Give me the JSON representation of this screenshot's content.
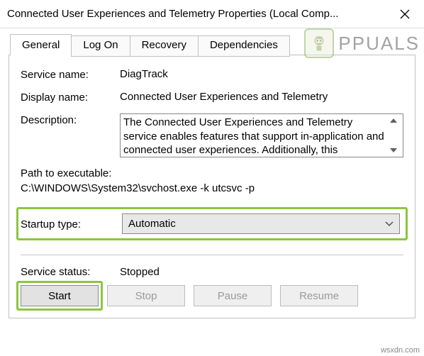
{
  "window": {
    "title": "Connected User Experiences and Telemetry Properties (Local Comp..."
  },
  "tabs": {
    "general": "General",
    "logon": "Log On",
    "recovery": "Recovery",
    "dependencies": "Dependencies"
  },
  "fields": {
    "service_name_label": "Service name:",
    "service_name_value": "DiagTrack",
    "display_name_label": "Display name:",
    "display_name_value": "Connected User Experiences and Telemetry",
    "description_label": "Description:",
    "description_value": "The Connected User Experiences and Telemetry service enables features that support in-application and connected user experiences. Additionally, this",
    "path_label": "Path to executable:",
    "path_value": "C:\\WINDOWS\\System32\\svchost.exe -k utcsvc -p",
    "startup_label": "Startup type:",
    "startup_value": "Automatic",
    "status_label": "Service status:",
    "status_value": "Stopped"
  },
  "buttons": {
    "start": "Start",
    "stop": "Stop",
    "pause": "Pause",
    "resume": "Resume"
  },
  "watermark": {
    "text": "PPUALS"
  },
  "siteref": "wsxdn.com"
}
